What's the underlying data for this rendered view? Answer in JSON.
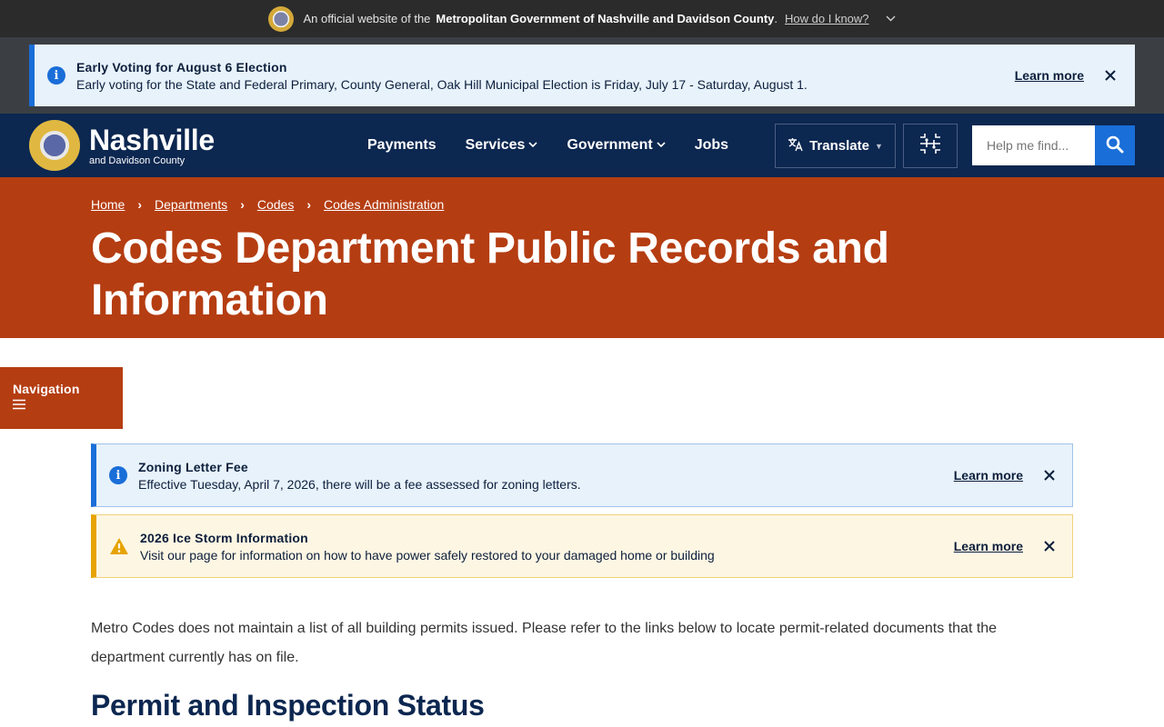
{
  "official_banner": {
    "prefix": "An official website of the",
    "org": "Metropolitan Government of Nashville and Davidson County",
    "period": ".",
    "link": "How do I know?"
  },
  "top_alert": {
    "title": "Early Voting for August 6 Election",
    "body": "Early voting for the State and Federal Primary, County General, Oak Hill Municipal Election is Friday, July 17 - Saturday, August 1.",
    "learn_more": "Learn more"
  },
  "header": {
    "logo_name": "Nashville",
    "logo_sub": "and Davidson County",
    "nav": [
      {
        "label": "Payments"
      },
      {
        "label": "Services"
      },
      {
        "label": "Government"
      },
      {
        "label": "Jobs"
      }
    ],
    "translate": "Translate",
    "search_placeholder": "Help me find..."
  },
  "breadcrumb": [
    "Home",
    "Departments",
    "Codes",
    "Codes Administration"
  ],
  "page_title": "Codes Department Public Records and Information",
  "navigation_toggle": "Navigation",
  "alerts": [
    {
      "title": "Zoning Letter Fee",
      "body": "Effective Tuesday, April 7, 2026, there will be a fee assessed for zoning letters.",
      "learn_more": "Learn more"
    },
    {
      "title": "2026 Ice Storm Information",
      "body": "Visit our page for information on how to have power safely restored to your damaged home or building",
      "learn_more": "Learn more"
    }
  ],
  "content": {
    "intro": "Metro Codes does not maintain a list of all building permits issued. Please refer to the links below to locate permit-related documents that the department currently has on file.",
    "heading": "Permit and Inspection Status"
  },
  "colors": {
    "header_bg": "#0c2750",
    "hero_bg": "#b53d12",
    "accent_blue": "#1a6ed8",
    "warning": "#e6a300"
  }
}
